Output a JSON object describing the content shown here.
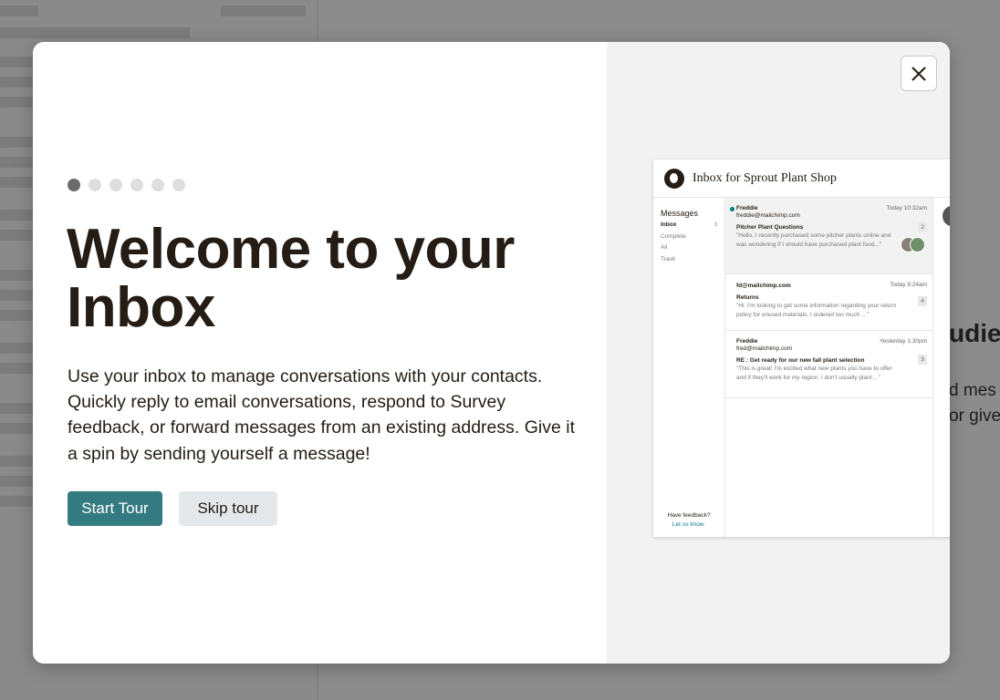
{
  "background": {
    "heading_fragment": "udien",
    "text_lines": [
      "d mes",
      "or give"
    ]
  },
  "modal": {
    "step_dots": {
      "total": 6,
      "active": 1
    },
    "title": "Welcome to your Inbox",
    "description": "Use your inbox to manage conversations with your contacts. Quickly reply to email conversations, respond to Survey feedback, or forward messages from an existing address. Give it a spin by sending yourself a message!",
    "start_tour_label": "Start Tour",
    "skip_tour_label": "Skip tour",
    "close_icon": "close-icon",
    "accent_color": "#337b81"
  },
  "preview": {
    "header_title": "Inbox for Sprout Plant Shop",
    "sidebar": {
      "title": "Messages",
      "items": [
        {
          "label": "Inbox",
          "count": "3"
        },
        {
          "label": "Complete",
          "count": ""
        },
        {
          "label": "All",
          "count": ""
        },
        {
          "label": "Trash",
          "count": ""
        }
      ],
      "feedback_text": "Have feedback?",
      "feedback_link": "Let us know."
    },
    "messages": [
      {
        "from": "Freddie",
        "email": "freddie@mailchimp.com",
        "time": "Today 10:32am",
        "count": "2",
        "subject": "Pitcher Plant Questions",
        "body": "\"Hello, I recently purchased some pitcher plants online and was wondering if I should have purchased plant food...\""
      },
      {
        "from": "",
        "email": "fd@mailchimp.com",
        "time": "Today 9:24am",
        "count": "4",
        "subject": "Returns",
        "body": "\"Hi. I'm looking to get some information regarding your return policy for unused materials. I ordered too much ...\""
      },
      {
        "from": "Freddie",
        "email": "fred@mailchimp.com",
        "time": "Yesterday 1:30pm",
        "count": "3",
        "subject": "RE : Get ready for our new fall plant selection",
        "body": "\"This is great! I'm excited what new plants you have to offer and if they'll work for my region. I don't usually plant... \""
      }
    ]
  }
}
